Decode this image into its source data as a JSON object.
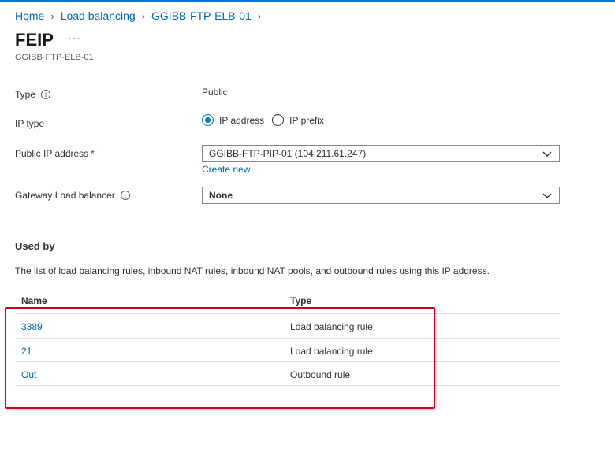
{
  "breadcrumb": {
    "items": [
      "Home",
      "Load balancing",
      "GGIBB-FTP-ELB-01"
    ]
  },
  "header": {
    "title": "FEIP",
    "more_label": "···",
    "subtitle": "GGIBB-FTP-ELB-01"
  },
  "form": {
    "type_label": "Type",
    "type_value": "Public",
    "ip_type_label": "IP type",
    "ip_type_options": [
      "IP address",
      "IP prefix"
    ],
    "ip_type_selected": "IP address",
    "public_ip_label": "Public IP address",
    "required_mark": "*",
    "public_ip_value": "GGIBB-FTP-PIP-01 (104.211.61.247)",
    "create_new_label": "Create new",
    "gateway_lb_label": "Gateway Load balancer",
    "gateway_lb_value": "None"
  },
  "used_by": {
    "title": "Used by",
    "description": "The list of load balancing rules, inbound NAT rules, inbound NAT pools, and outbound rules using this IP address.",
    "columns": [
      "Name",
      "Type"
    ],
    "rows": [
      {
        "name": "3389",
        "type": "Load balancing rule"
      },
      {
        "name": "21",
        "type": "Load balancing rule"
      },
      {
        "name": "Out",
        "type": "Outbound rule"
      }
    ]
  },
  "colors": {
    "link": "#0067b8",
    "accent": "#0078d4",
    "highlight": "#d0021b"
  },
  "icons": {
    "info": "info-icon",
    "chevron": "chevron-down-icon",
    "breadcrumb_sep": "chevron-right-icon"
  }
}
